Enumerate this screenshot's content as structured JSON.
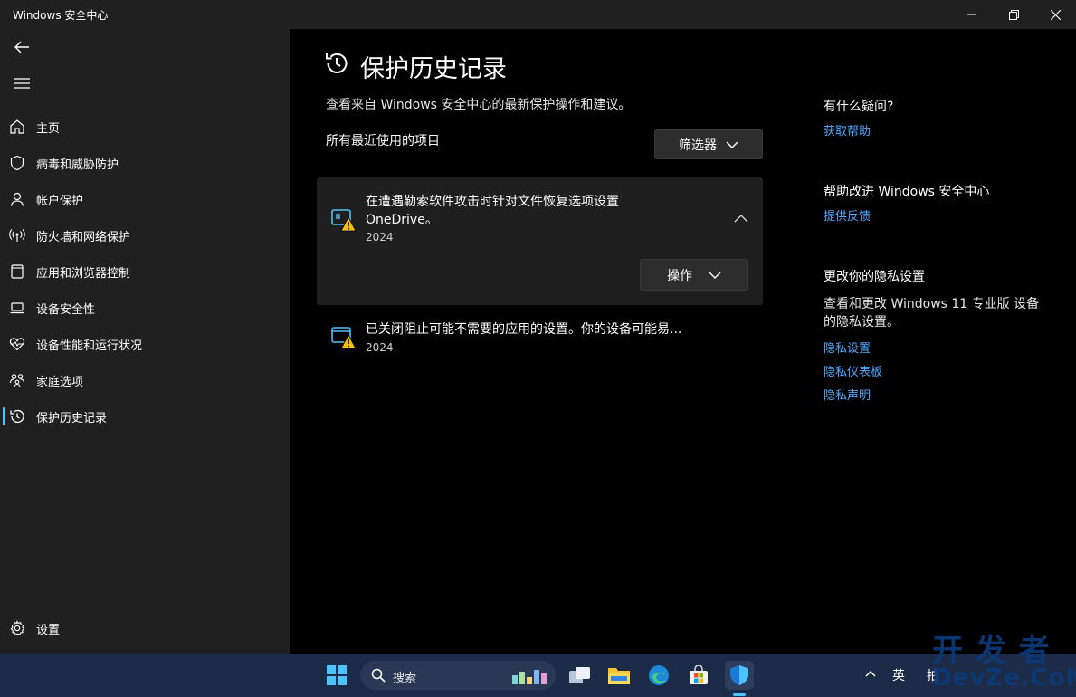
{
  "window": {
    "title": "Windows 安全中心"
  },
  "sidebar": {
    "items": [
      {
        "label": "主页",
        "icon": "home-icon"
      },
      {
        "label": "病毒和威胁防护",
        "icon": "shield-icon"
      },
      {
        "label": "帐户保护",
        "icon": "person-icon"
      },
      {
        "label": "防火墙和网络保护",
        "icon": "antenna-icon"
      },
      {
        "label": "应用和浏览器控制",
        "icon": "app-window-icon"
      },
      {
        "label": "设备安全性",
        "icon": "laptop-icon"
      },
      {
        "label": "设备性能和运行状况",
        "icon": "heart-pulse-icon"
      },
      {
        "label": "家庭选项",
        "icon": "family-icon"
      },
      {
        "label": "保护历史记录",
        "icon": "history-icon",
        "active": true
      }
    ],
    "settings_label": "设置"
  },
  "main": {
    "title": "保护历史记录",
    "subtitle": "查看来自 Windows 安全中心的最新保护操作和建议。",
    "section_label": "所有最近使用的项目",
    "filter_label": "筛选器",
    "cards": [
      {
        "title_line1": "在遭遇勒索软件攻击时针对文件恢复选项设置",
        "title_line2": "OneDrive。",
        "date": "2024",
        "action_label": "操作",
        "expanded": true
      },
      {
        "title": "已关闭阻止可能不需要的应用的设置。你的设备可能易...",
        "date": "2024",
        "expanded": false
      }
    ]
  },
  "right_panel": {
    "question_heading": "有什么疑问?",
    "get_help": "获取帮助",
    "improve_heading": "帮助改进 Windows 安全中心",
    "feedback": "提供反馈",
    "privacy_heading": "更改你的隐私设置",
    "privacy_text": "查看和更改 Windows 11 专业版 设备的隐私设置。",
    "privacy_links": [
      "隐私设置",
      "隐私仪表板",
      "隐私声明"
    ]
  },
  "taskbar": {
    "search_placeholder": "搜索",
    "tray_lang": "英",
    "tray_partial": "拍"
  },
  "watermark": {
    "line1": "开 发 者",
    "line2": "DevZe.CoM"
  },
  "colors": {
    "accent": "#4cc2ff",
    "link": "#4ea8ff",
    "warning": "#f6c000",
    "sidebar_bg": "#202020",
    "taskbar_bg": "#1c2b48"
  }
}
